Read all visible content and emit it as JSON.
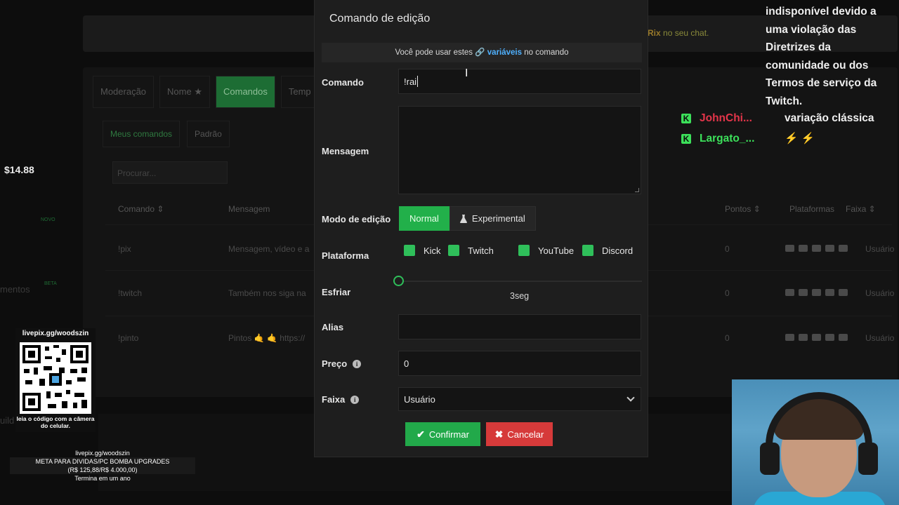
{
  "background": {
    "notice_name": "tRix",
    "notice_text": "no seu chat.",
    "tabs": [
      {
        "label": "Moderação",
        "active": false
      },
      {
        "label": "Nome ★",
        "active": false
      },
      {
        "label": "Comandos",
        "active": true
      },
      {
        "label": "Temp",
        "active": false
      }
    ],
    "subtabs": [
      {
        "label": "Meus comandos",
        "active": true
      },
      {
        "label": "Padrão",
        "active": false
      }
    ],
    "search_placeholder": "Procurar...",
    "columns": {
      "command": "Comando ⇕",
      "message": "Mensagem",
      "points": "Pontos ⇕",
      "platforms": "Plataformas",
      "band": "Faixa ⇕"
    },
    "rows": [
      {
        "command": "!pix",
        "message": "Mensagem, vídeo e a",
        "points": "0",
        "band": "Usuário"
      },
      {
        "command": "!twitch",
        "message": "Também nos siga na",
        "points": "0",
        "band": "Usuário"
      },
      {
        "command": "!pinto",
        "message": "Pintos 🤙 🤙 https://",
        "points": "0",
        "band": "Usuário"
      }
    ]
  },
  "overlay": {
    "money": "$14.88",
    "novo_badge": "NOVO",
    "beta_badge": "BETA",
    "side_fragment_1": "mentos",
    "side_fragment_2": "uild",
    "qr_title": "livepix.gg/woodszin",
    "qr_caption": "leia o código com a câmera do celular.",
    "goal_url": "livepix.gg/woodszin",
    "goal_title": "META PARA DIVIDAS/PC BOMBA UPGRADES",
    "goal_amount": "(R$ 125,88/R$ 4.000,00)",
    "goal_end": "Termina em um ano"
  },
  "chat": {
    "system_message": "indisponível devido a uma violação das Diretrizes da comunidade ou dos Termos de serviço da Twitch.",
    "messages": [
      {
        "user": "JohnChi...",
        "text": "variação clássica",
        "badge": "K"
      },
      {
        "user": "Largato_...",
        "text": "⚡ ⚡",
        "badge": "K"
      }
    ]
  },
  "modal": {
    "title": "Comando de edição",
    "vars_prefix": "Você pode usar estes",
    "vars_link": "🔗 variáveis",
    "vars_suffix": "no comando",
    "command_label": "Comando",
    "command_value": "!rai",
    "message_label": "Mensagem",
    "message_value": "",
    "mode_label": "Modo de edição",
    "mode_normal": "Normal",
    "mode_experimental": "Experimental",
    "platform_label": "Plataforma",
    "platforms": [
      {
        "name": "Kick",
        "checked": true
      },
      {
        "name": "Twitch",
        "checked": true
      },
      {
        "name": "YouTube",
        "checked": true
      },
      {
        "name": "Discord",
        "checked": true
      }
    ],
    "cooldown_label": "Esfriar",
    "cooldown_value": "3seg",
    "cooldown_fraction": 0,
    "alias_label": "Alias",
    "alias_value": "",
    "price_label": "Preço",
    "price_value": "0",
    "band_label": "Faixa",
    "band_value": "Usuário",
    "confirm_label": "Confirmar",
    "cancel_label": "Cancelar"
  },
  "colors": {
    "accent_green": "#22b04a",
    "danger_red": "#d63a3a",
    "link_blue": "#4fb1ff"
  }
}
